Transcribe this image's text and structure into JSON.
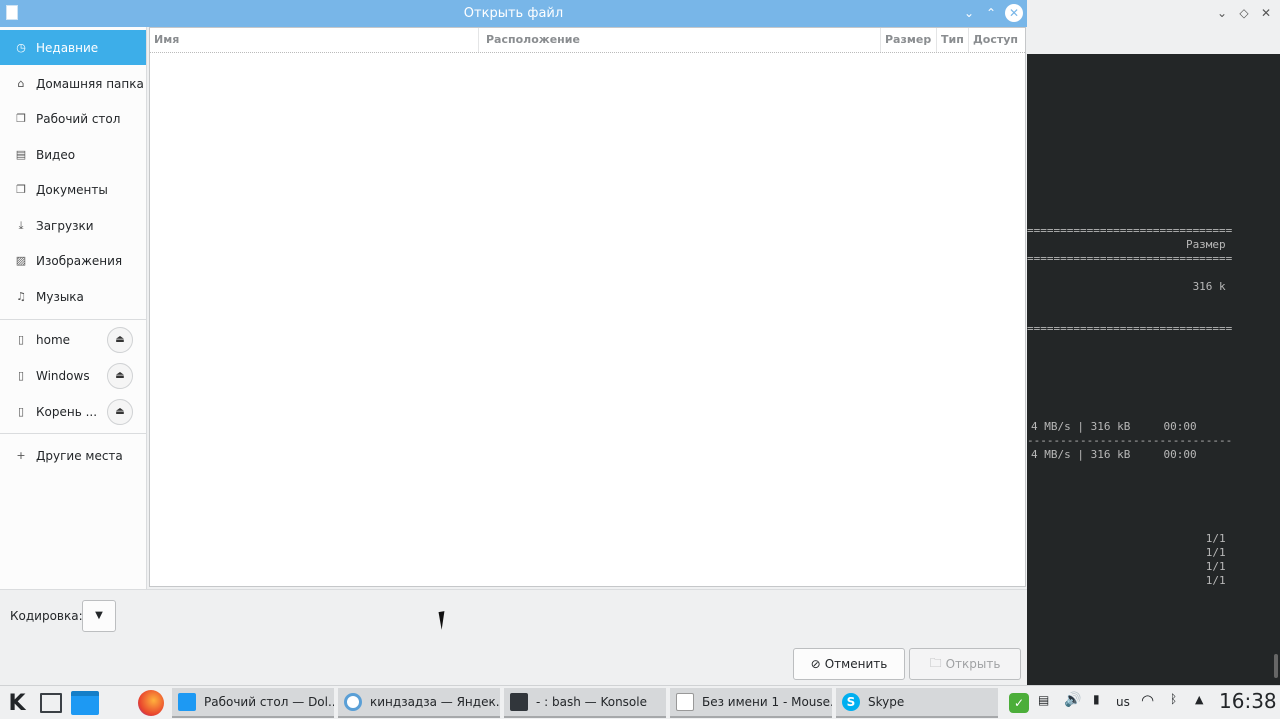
{
  "dialog": {
    "title": "Открыть файл",
    "sidebar": {
      "places": [
        {
          "label": "Недавние",
          "icon": "clock-icon",
          "active": true
        },
        {
          "label": "Домашняя папка",
          "icon": "home-icon"
        },
        {
          "label": "Рабочий стол",
          "icon": "desktop-folder-icon"
        },
        {
          "label": "Видео",
          "icon": "film-icon"
        },
        {
          "label": "Документы",
          "icon": "documents-icon"
        },
        {
          "label": "Загрузки",
          "icon": "download-icon"
        },
        {
          "label": "Изображения",
          "icon": "image-icon"
        },
        {
          "label": "Музыка",
          "icon": "music-note-icon"
        }
      ],
      "devices": [
        {
          "label": "home",
          "icon": "drive-icon"
        },
        {
          "label": "Windows",
          "icon": "drive-icon"
        },
        {
          "label": "Корень ...",
          "icon": "drive-icon"
        }
      ],
      "other": {
        "label": "Другие места",
        "icon": "plus-icon"
      }
    },
    "columns": [
      "Имя",
      "Расположение",
      "Размер",
      "Тип",
      "Доступ"
    ],
    "encoding_label": "Кодировка:",
    "cancel_label": "Отменить",
    "open_label": "Открыть"
  },
  "terminal": {
    "lines": [
      "===============================",
      "                        Размер",
      "===============================",
      "                         316 k",
      "===============================",
      "4 MB/s | 316 kB     00:00",
      "-------------------------------",
      "4 MB/s | 316 kB     00:00",
      "                           1/1",
      "                           1/1",
      "                           1/1",
      "                           1/1"
    ]
  },
  "taskbar": {
    "tasks": [
      {
        "label": "Рабочий стол — Dol...",
        "icon": "folder-icon"
      },
      {
        "label": "киндзадза — Яндек...",
        "icon": "browser-icon"
      },
      {
        "label": "- : bash — Konsole",
        "icon": "terminal-icon"
      },
      {
        "label": "Без имени 1 - Mouse...",
        "icon": "text-editor-icon"
      },
      {
        "label": "Skype",
        "icon": "skype-icon"
      }
    ],
    "keyboard_layout": "us",
    "clock": "16:38"
  },
  "colors": {
    "accent": "#3daee9",
    "titlebar": "#78b6e8",
    "terminal_bg": "#232627"
  }
}
